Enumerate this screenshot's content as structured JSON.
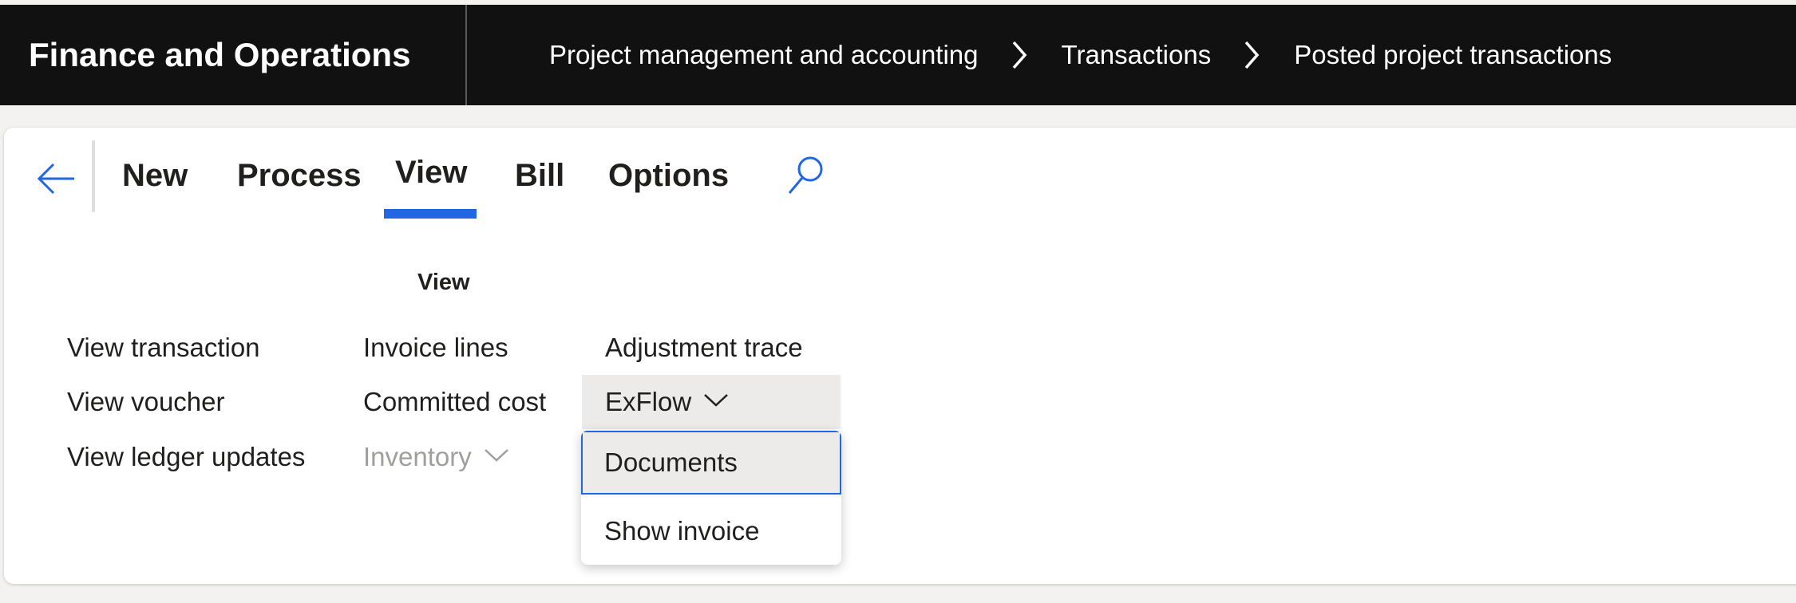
{
  "header": {
    "app_title": "Finance and Operations",
    "breadcrumb": [
      "Project management and accounting",
      "Transactions",
      "Posted project transactions"
    ]
  },
  "tabs": {
    "new": "New",
    "process": "Process",
    "view": "View",
    "bill": "Bill",
    "options": "Options",
    "active": "View"
  },
  "view_group": {
    "label": "View",
    "col1": [
      "View transaction",
      "View voucher",
      "View ledger updates"
    ],
    "col2": [
      "Invoice lines",
      "Committed cost",
      "Inventory"
    ],
    "col3_top": "Adjustment trace",
    "exflow": "ExFlow"
  },
  "exflow_menu": {
    "items": [
      "Documents",
      "Show invoice"
    ],
    "selected": "Documents"
  },
  "colors": {
    "header_bg": "#111111",
    "accent": "#2266e3",
    "disabled_text": "#a19f9d",
    "hover_bg": "#edebe9"
  },
  "icons": {
    "back": "arrow-left-icon",
    "search": "search-icon",
    "breadcrumb_separator": "chevron-right-icon",
    "dropdown": "chevron-down-icon"
  }
}
